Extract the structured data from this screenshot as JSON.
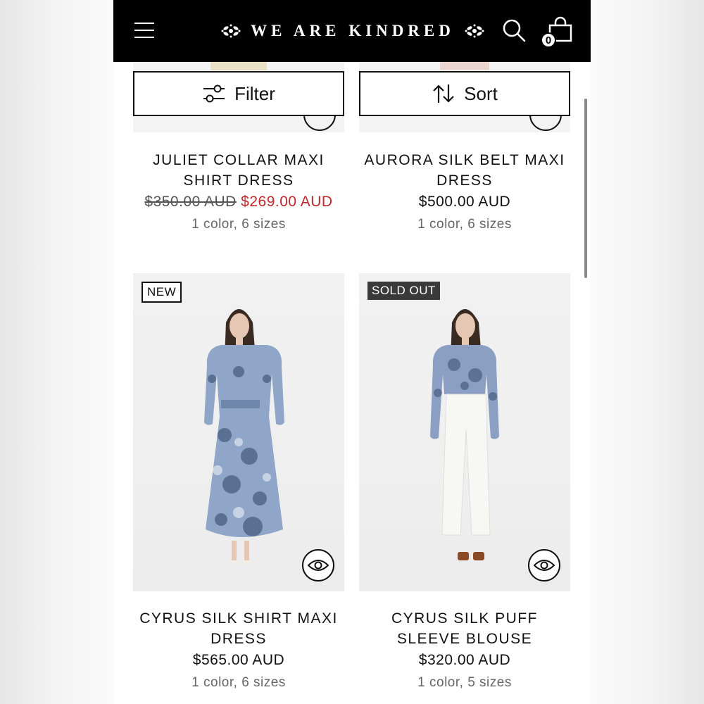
{
  "header": {
    "logo_text": "WE ARE KINDRED",
    "cart_count": "0",
    "icons": [
      "menu-icon",
      "search-icon",
      "shopping-bag-icon"
    ]
  },
  "toolbar": {
    "filter_label": "Filter",
    "sort_label": "Sort"
  },
  "products": [
    {
      "name": "JULIET COLLAR MAXI SHIRT DRESS",
      "price_original": "$350.00 AUD",
      "price_sale": "$269.00 AUD",
      "meta": "1 color, 6 sizes"
    },
    {
      "name": "AURORA SILK BELT MAXI DRESS",
      "price": "$500.00 AUD",
      "meta": "1 color, 6 sizes"
    },
    {
      "name": "CYRUS SILK SHIRT MAXI DRESS",
      "price": "$565.00 AUD",
      "meta": "1 color, 6 sizes",
      "badge": "NEW"
    },
    {
      "name": "CYRUS SILK PUFF SLEEVE BLOUSE",
      "price": "$320.00 AUD",
      "meta": "1 color, 5 sizes",
      "badge": "SOLD OUT"
    }
  ],
  "colors": {
    "header_bg": "#000000",
    "sale_price": "#c0272d",
    "badge_sold_bg": "#3a3a3a"
  }
}
